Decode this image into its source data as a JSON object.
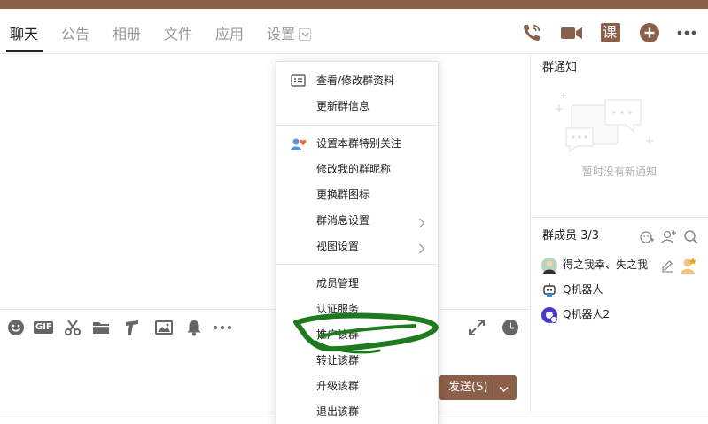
{
  "colors": {
    "brand": "#8b5f49",
    "annotation": "#1e7a1e"
  },
  "tabs": [
    {
      "label": "聊天",
      "active": true
    },
    {
      "label": "公告",
      "active": false
    },
    {
      "label": "相册",
      "active": false
    },
    {
      "label": "文件",
      "active": false
    },
    {
      "label": "应用",
      "active": false
    },
    {
      "label": "设置",
      "active": false
    }
  ],
  "header_icons": [
    "phone-icon",
    "video-call-icon",
    "class-icon",
    "add-circle-icon",
    "more-icon"
  ],
  "header_class_glyph": "课",
  "toolbar_icons": [
    "emoji-icon",
    "gif-icon",
    "scissors-icon",
    "folder-icon",
    "music-icon",
    "image-icon",
    "bell-icon",
    "more-icon",
    "expand-icon",
    "history-clock-icon"
  ],
  "toolbar_gif_text": "GIF",
  "send_button": {
    "label": "发送(S)"
  },
  "notice": {
    "title": "群通知",
    "empty_text": "暂时没有新通知"
  },
  "members": {
    "title": "群成员 3/3",
    "list": [
      {
        "name": "得之我幸、失之我"
      },
      {
        "name": "Q机器人"
      },
      {
        "name": "Q机器人2"
      }
    ]
  },
  "menu": {
    "groups": [
      [
        {
          "label": "查看/修改群资料",
          "icon": "profile-card-icon"
        },
        {
          "label": "更新群信息"
        }
      ],
      [
        {
          "label": "设置本群特别关注",
          "icon": "special-care-icon"
        },
        {
          "label": "修改我的群昵称"
        },
        {
          "label": "更换群图标"
        },
        {
          "label": "群消息设置",
          "submenu": true
        },
        {
          "label": "视图设置",
          "submenu": true
        }
      ],
      [
        {
          "label": "成员管理"
        },
        {
          "label": "认证服务"
        },
        {
          "label": "推广该群"
        },
        {
          "label": "转让该群"
        },
        {
          "label": "升级该群"
        },
        {
          "label": "退出该群"
        }
      ]
    ]
  }
}
